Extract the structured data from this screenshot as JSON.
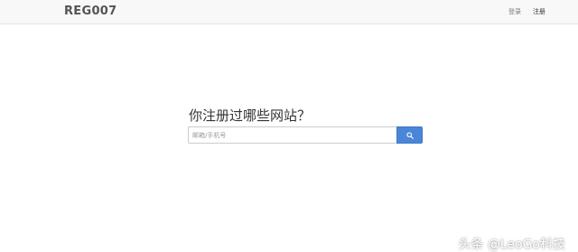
{
  "brand": "REG007",
  "nav": {
    "login": "登录",
    "register": "注册"
  },
  "main": {
    "heading": "你注册过哪些网站？",
    "search": {
      "placeholder": "邮箱/手机号",
      "button_icon": "search-icon"
    }
  },
  "watermark": "头条 @LeoGo科技",
  "colors": {
    "navbar_bg": "#f8f8f8",
    "search_button": "#4a86d8"
  }
}
